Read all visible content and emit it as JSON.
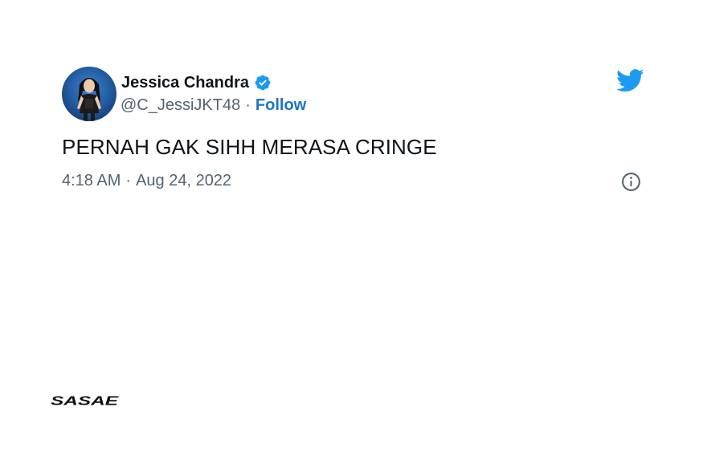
{
  "tweet": {
    "author": {
      "display_name": "Jessica Chandra",
      "handle": "@C_JessiJKT48",
      "verified": true,
      "avatar_icon": "profile-photo"
    },
    "follow_label": "Follow",
    "separator": "·",
    "text": "PERNAH GAK SIHH MERASA CRINGE",
    "time": "4:18 AM",
    "date": "Aug 24, 2022"
  },
  "icons": {
    "brand": "twitter-bird-icon",
    "verified": "verified-badge-icon",
    "info": "info-icon"
  },
  "watermark": {
    "text": "SASAE"
  },
  "colors": {
    "twitter_blue": "#1d9bf0",
    "follow_blue": "#1d74c4",
    "secondary_text": "#536471",
    "primary_text": "#0f1419",
    "background": "#ffffff"
  }
}
